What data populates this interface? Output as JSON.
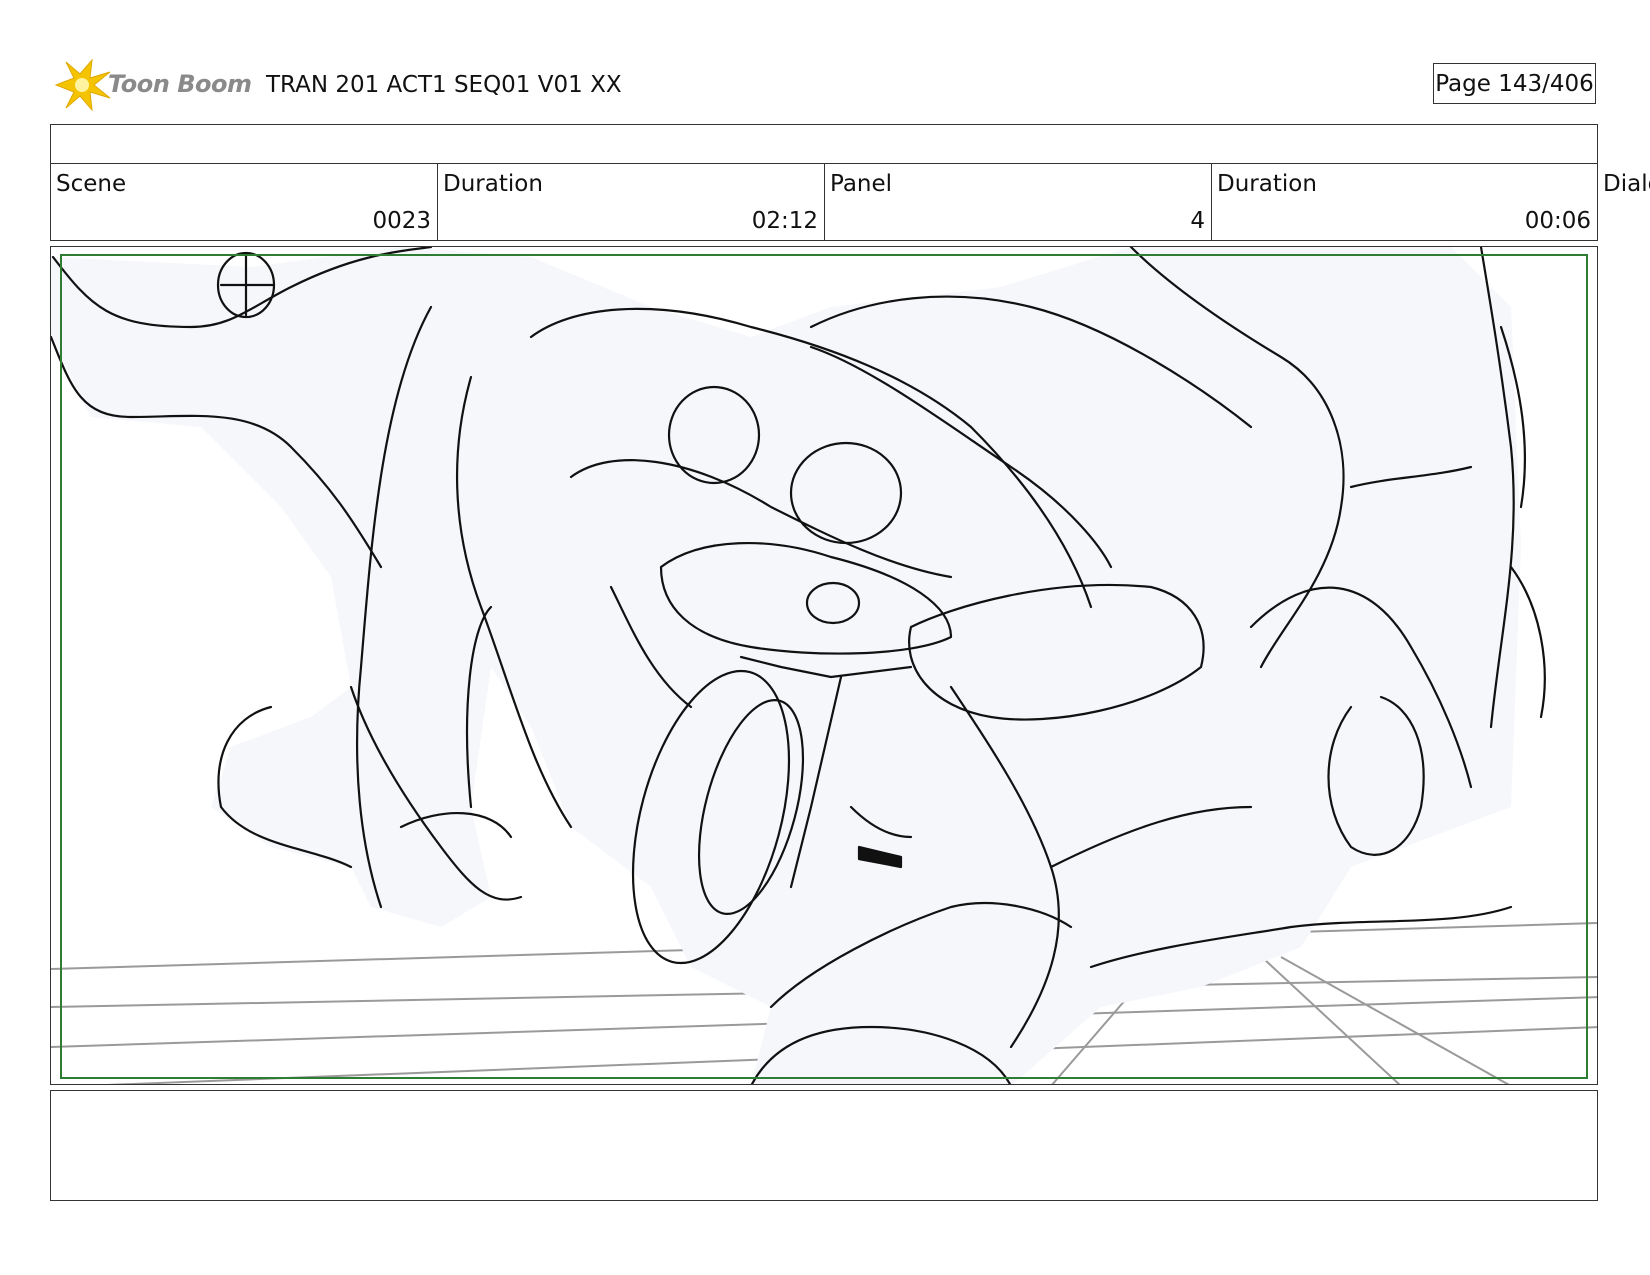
{
  "header": {
    "logo_text": "Toon Boom",
    "title": "TRAN 201 ACT1 SEQ01 V01 XX",
    "page": "Page 143/406"
  },
  "info": {
    "scene_label": "Scene",
    "scene_value": "0023",
    "scene_duration_label": "Duration",
    "scene_duration_value": "02:12",
    "panel_label": "Panel",
    "panel_value": "4",
    "panel_duration_label": "Duration",
    "panel_duration_value": "00:06",
    "dialog_label": "Dialo"
  },
  "colors": {
    "safe_frame": "#2e7d32",
    "logo_star": "#f5c400",
    "sketch_fill": "#f6f7fb"
  },
  "panel": {
    "content": "storyboard-sketch",
    "notes": ""
  }
}
